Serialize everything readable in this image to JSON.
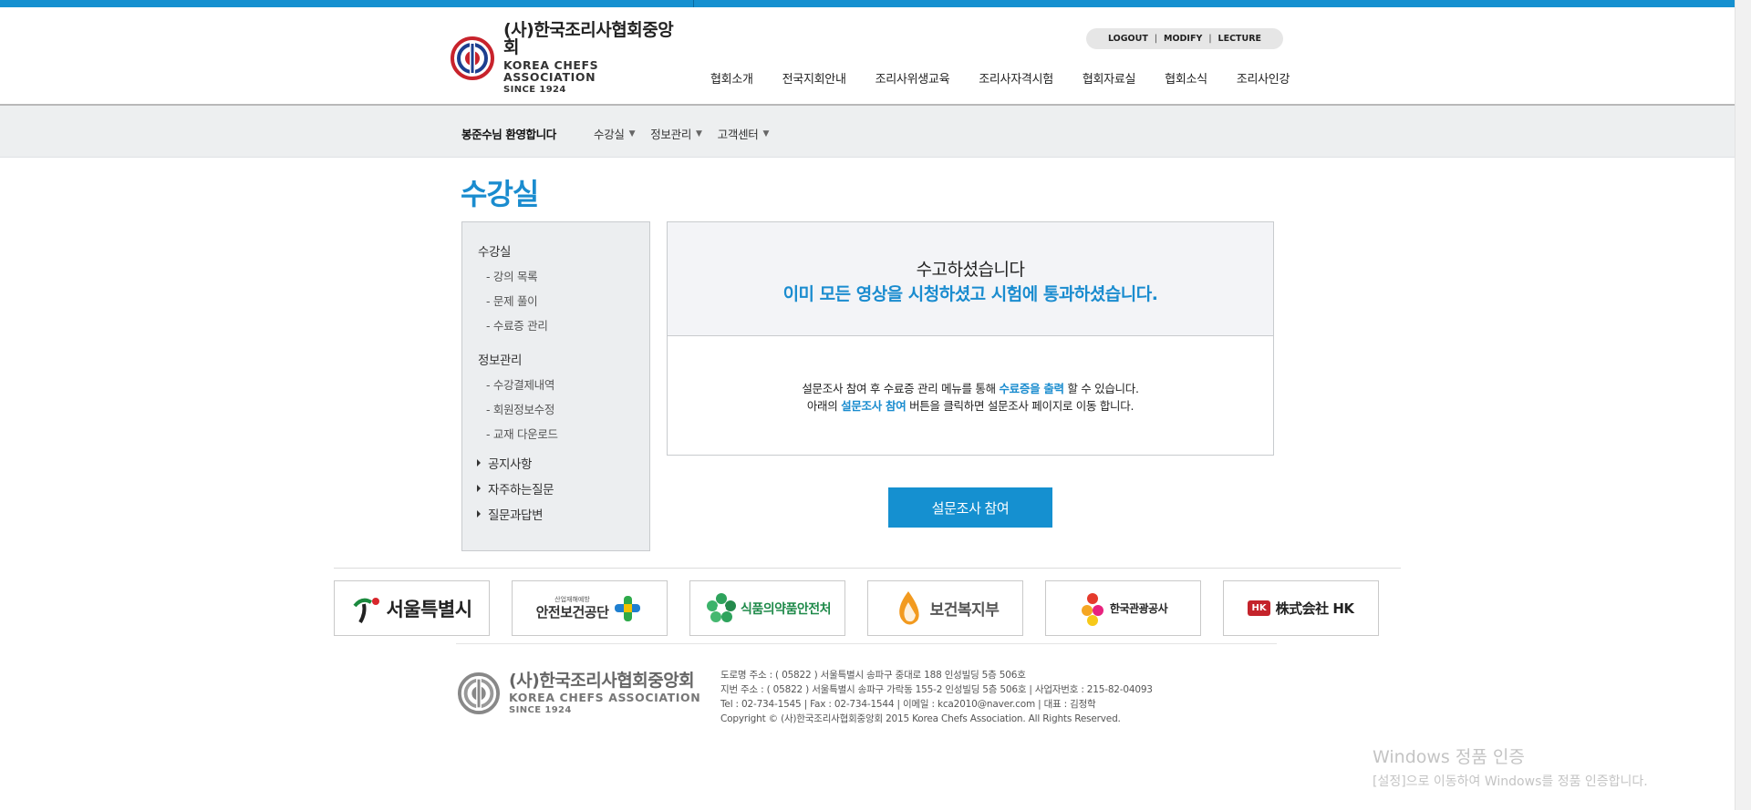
{
  "header": {
    "logo": {
      "name_ko": "(사)한국조리사협회중앙회",
      "name_en": "KOREA CHEFS ASSOCIATION",
      "since": "SINCE 1924"
    },
    "util_links": [
      "LOGOUT",
      "MODIFY",
      "LECTURE"
    ],
    "nav": [
      "협회소개",
      "전국지회안내",
      "조리사위생교육",
      "조리사자격시험",
      "협회자료실",
      "협회소식",
      "조리사인강"
    ]
  },
  "subbar": {
    "welcome": "봉준수님 환영합니다",
    "menus": [
      "수강실",
      "정보관리",
      "고객센터"
    ]
  },
  "page_title": "수강실",
  "sidebar": {
    "group1": "수강실",
    "group1_items": [
      "- 강의 목록",
      "- 문제 풀이",
      "- 수료증 관리"
    ],
    "group2": "정보관리",
    "group2_items": [
      "- 수강결제내역",
      "- 회원정보수정",
      "- 교재 다운로드"
    ],
    "links": [
      "공지사항",
      "자주하는질문",
      "질문과답변"
    ]
  },
  "message": {
    "title": "수고하셨습니다",
    "strong": "이미 모든 영상을 시청하셨고 시험에 통과하셨습니다.",
    "line1": {
      "pre": "설문조사 참여 후 수료증 관리 메뉴를 통해 ",
      "hl": "수료증을 출력",
      "post": " 할 수 있습니다."
    },
    "line2": {
      "pre": "아래의 ",
      "hl": "설문조사 참여",
      "post": " 버튼을 클릭하면 설문조사 페이지로 이동 합니다."
    },
    "button": "설문조사 참여"
  },
  "partners": [
    "서울특별시",
    "안전보건공단",
    "식품의약품안전처",
    "보건복지부",
    "한국관광공사",
    "株式会社 HK"
  ],
  "partner_small_text": {
    "safety": "산업재해예방",
    "hk_badge": "HK"
  },
  "footer": {
    "logo": {
      "name_ko": "(사)한국조리사협회중앙회",
      "name_en": "KOREA CHEFS ASSOCIATION",
      "since": "SINCE 1924"
    },
    "lines": [
      "도로명 주소 : ( 05822 ) 서울특별시 송파구 중대로 188 인성빌딩 5층 506호",
      "지번 주소 : ( 05822 ) 서울특별시 송파구 가락동 155-2 인성빌딩 5층 506호   |   사업자번호 : 215-82-04093",
      "Tel : 02-734-1545   |   Fax : 02-734-1544   |   이메일 : kca2010@naver.com   |   대표 : 김정학",
      "Copyright © (사)한국조리사협회중앙회 2015 Korea Chefs Association. All Rights Reserved."
    ]
  },
  "watermark": {
    "line1": "Windows 정품 인증",
    "line2": "[설정]으로 이동하여 Windows를 정품 인증합니다."
  },
  "colors": {
    "accent": "#1590d0",
    "title_blue": "#1a8ccf"
  }
}
